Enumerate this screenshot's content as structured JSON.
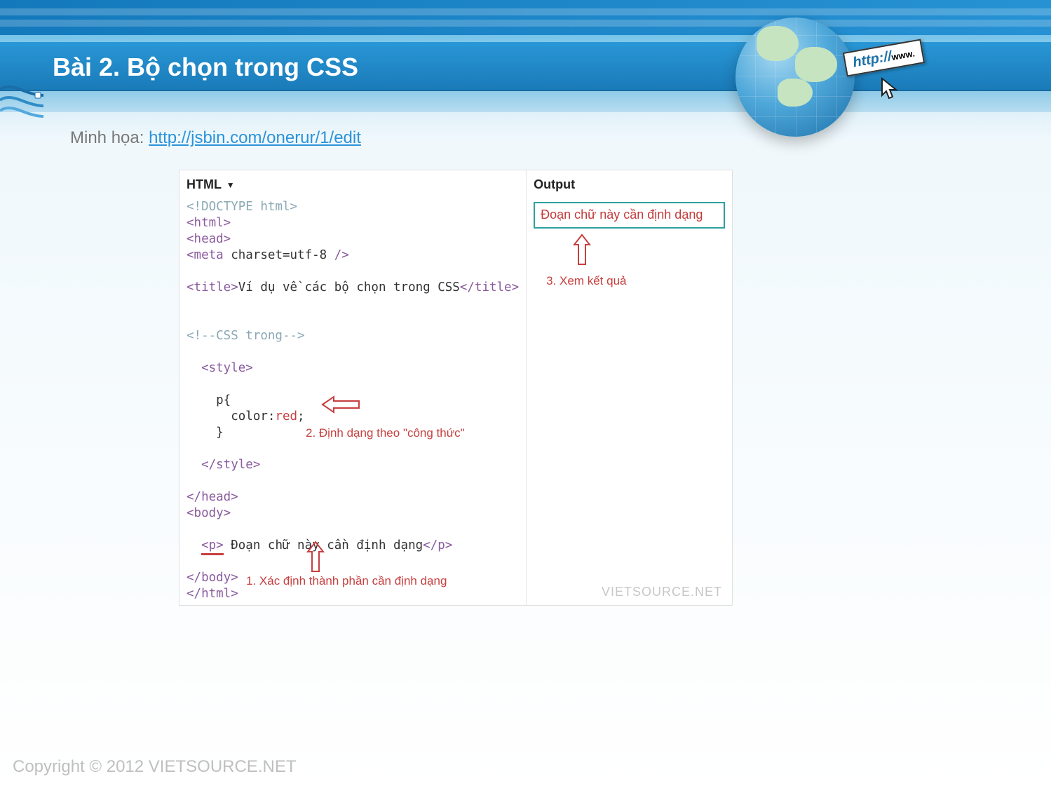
{
  "header": {
    "title": "Bài 2. Bộ chọn trong CSS"
  },
  "intro": {
    "label": "Minh họa:",
    "link_text": "http://jsbin.com/onerur/1/edit"
  },
  "globe": {
    "tag_label": "http://",
    "tag_suffix": "www."
  },
  "editor": {
    "left_header": "HTML",
    "right_header": "Output",
    "code_lines": {
      "l1a": "<!DOCTYPE html>",
      "l2": "<html>",
      "l3": "<head>",
      "l4a": "<meta",
      "l4b": " charset=utf-8 ",
      "l4c": "/>",
      "l5a": "<title>",
      "l5b": "Ví dụ về các bộ chọn trong CSS",
      "l5c": "</title>",
      "l6": "<!--CSS trong-->",
      "l7": "  <style>",
      "l8": "    p{",
      "l9a": "      color:",
      "l9b": "red",
      "l9c": ";",
      "l10": "    }",
      "l11": "  </style>",
      "l12": "</head>",
      "l13": "<body>",
      "l14a": "  ",
      "l14b": "<p>",
      "l14c": " Đoạn chữ này cần định dạng",
      "l14d": "</p>",
      "l15": "</body>",
      "l16": "</html>"
    },
    "annotations": {
      "a1": "1. Xác định thành phần cần định dạng",
      "a2": "2. Định dạng theo \"công thức\"",
      "a3": "3. Xem kết quả"
    },
    "output_text": "Đoạn chữ này cần định dạng",
    "watermark": "VIETSOURCE.NET"
  },
  "footer": {
    "copyright": "Copyright © 2012 VIETSOURCE.NET"
  }
}
